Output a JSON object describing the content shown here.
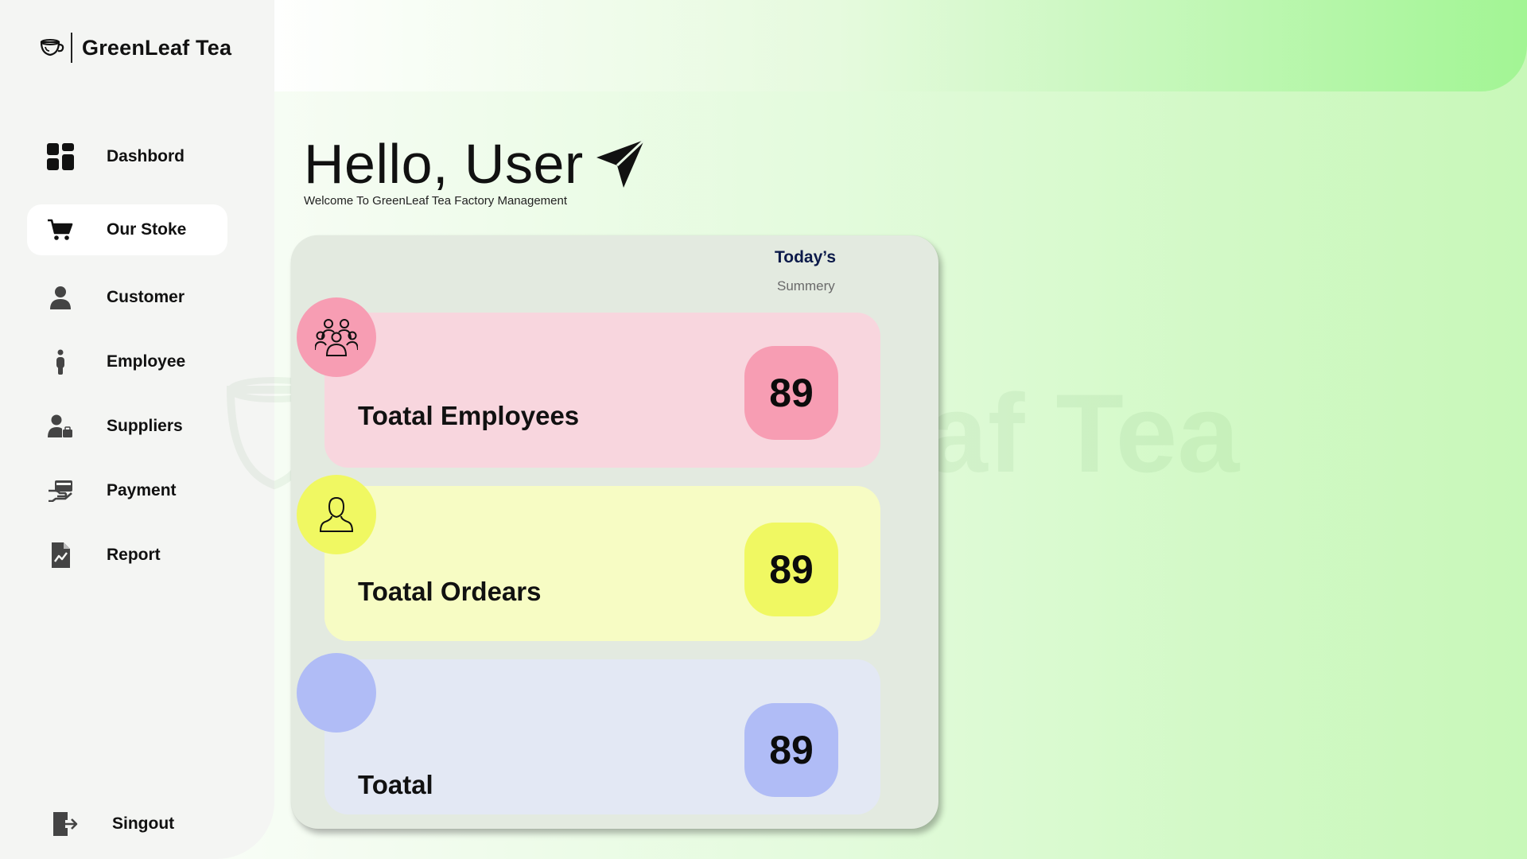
{
  "app": {
    "brand": "GreenLeaf Tea",
    "watermark": "GreenLeaf Tea"
  },
  "sidebar": {
    "items": [
      {
        "label": "Dashbord",
        "icon": "dashboard-icon",
        "active": false
      },
      {
        "label": "Our Stoke",
        "icon": "cart-icon",
        "active": true
      },
      {
        "label": "Customer",
        "icon": "person-icon",
        "active": false
      },
      {
        "label": "Employee",
        "icon": "employee-icon",
        "active": false
      },
      {
        "label": "Suppliers",
        "icon": "supplier-icon",
        "active": false
      },
      {
        "label": "Payment",
        "icon": "payment-icon",
        "active": false
      },
      {
        "label": "Report",
        "icon": "report-icon",
        "active": false
      }
    ],
    "signout": {
      "label": "Singout",
      "icon": "signout-icon"
    }
  },
  "header": {
    "greeting": "Hello, User",
    "subtitle": "Welcome To GreenLeaf Tea Factory Management"
  },
  "summary": {
    "heading": "Today’s",
    "subheading": "Summery",
    "stats": [
      {
        "label": "Toatal Employees",
        "value": "89",
        "icon": "group-icon",
        "card_color": "#f8d6de",
        "accent_color": "#f79db3"
      },
      {
        "label": "Toatal Ordears",
        "value": "89",
        "icon": "user-outline-icon",
        "card_color": "#f7fcc4",
        "accent_color": "#f0f862"
      },
      {
        "label": "Toatal",
        "value": "89",
        "icon": "",
        "card_color": "#e3e8f4",
        "accent_color": "#b0bcf6"
      }
    ]
  },
  "colors": {
    "accent_green": "#a2f594",
    "sidebar_bg": "#f4f5f3",
    "summary_bg": "#e3eae0"
  }
}
